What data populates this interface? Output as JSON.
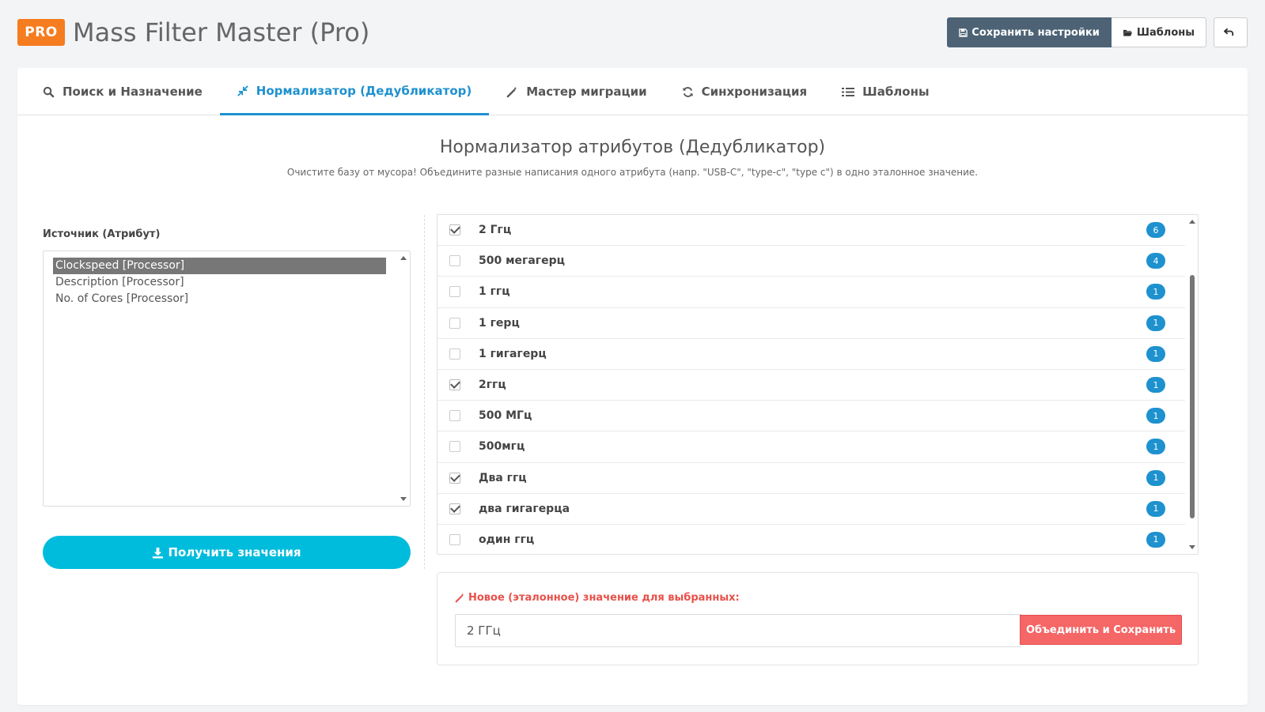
{
  "header": {
    "badge": "PRO",
    "title": "Mass Filter Master (Pro)",
    "save_label": "Сохранить настройки",
    "templates_label": "Шаблоны"
  },
  "tabs": [
    {
      "label": "Поиск и Назначение",
      "icon": "search-icon",
      "active": false
    },
    {
      "label": "Нормализатор (Дедубликатор)",
      "icon": "compress-icon",
      "active": true
    },
    {
      "label": "Мастер миграции",
      "icon": "magic-wand-icon",
      "active": false
    },
    {
      "label": "Синхронизация",
      "icon": "refresh-icon",
      "active": false
    },
    {
      "label": "Шаблоны",
      "icon": "list-icon",
      "active": false
    }
  ],
  "section": {
    "title": "Нормализатор атрибутов (Дедубликатор)",
    "subtitle": "Очистите базу от мусора! Объедините разные написания одного атрибута (напр. \"USB-C\", \"type-c\", \"type c\") в одно эталонное значение."
  },
  "source": {
    "label": "Источник (Атрибут)",
    "items": [
      "Clockspeed [Processor]",
      "Description [Processor]",
      "No. of Cores [Processor]"
    ],
    "selected_index": 0
  },
  "fetch_label": "Получить значения",
  "values": [
    {
      "text": "2 Ггц",
      "count": "6",
      "checked": true
    },
    {
      "text": "500 мегагерц",
      "count": "4",
      "checked": false
    },
    {
      "text": "1 ггц",
      "count": "1",
      "checked": false
    },
    {
      "text": "1 герц",
      "count": "1",
      "checked": false
    },
    {
      "text": "1 гигагерц",
      "count": "1",
      "checked": false
    },
    {
      "text": "2ггц",
      "count": "1",
      "checked": true
    },
    {
      "text": "500 МГц",
      "count": "1",
      "checked": false
    },
    {
      "text": "500мгц",
      "count": "1",
      "checked": false
    },
    {
      "text": "Два ггц",
      "count": "1",
      "checked": true
    },
    {
      "text": "два гигагерца",
      "count": "1",
      "checked": true
    },
    {
      "text": "один ггц",
      "count": "1",
      "checked": false
    }
  ],
  "merge": {
    "label": "Новое (эталонное) значение для выбранных:",
    "value": "2 ГГц",
    "button_label": "Объединить и Сохранить"
  },
  "colors": {
    "accent": "#1e91cf",
    "badge": "#f57c1f",
    "fetch": "#00bcdc",
    "merge": "#f56666",
    "save": "#4d6375"
  }
}
